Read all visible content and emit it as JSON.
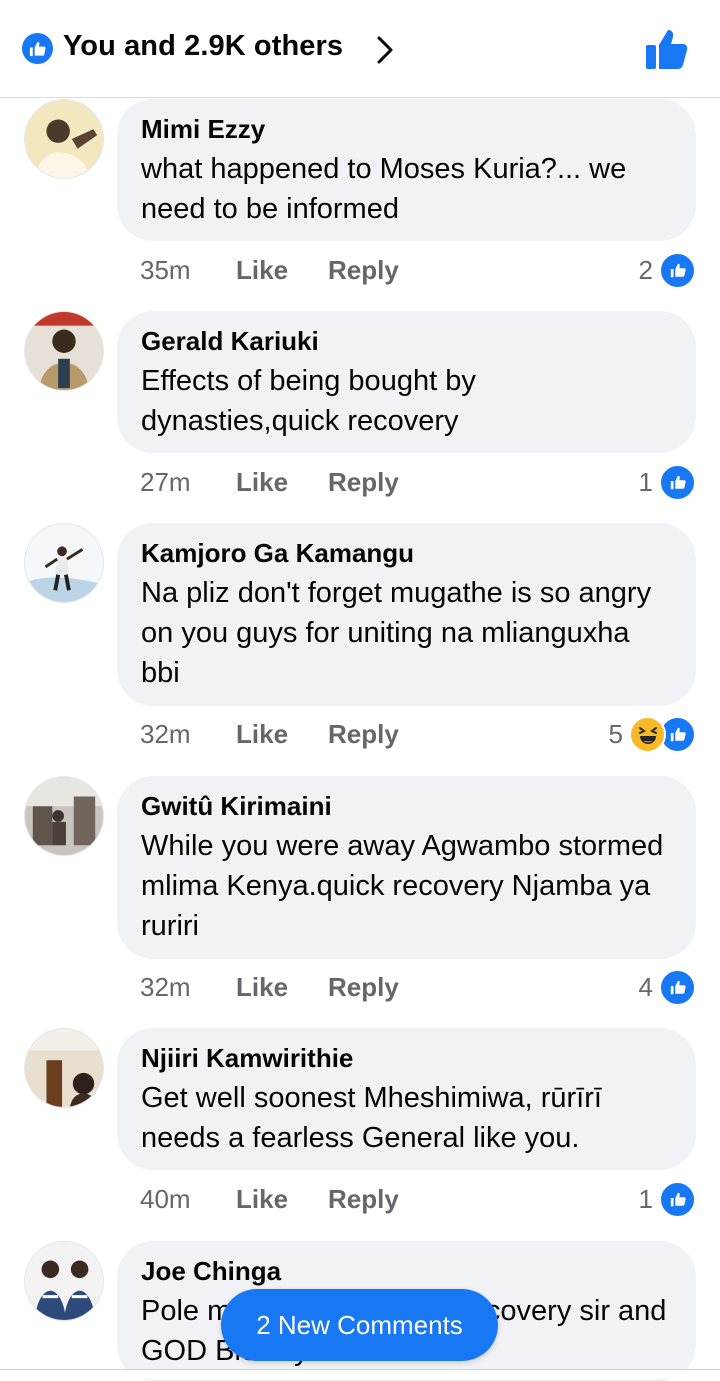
{
  "header": {
    "reactions_text": "You and 2.9K others",
    "like_icon": "like-icon",
    "chevron_icon": "chevron-right-icon",
    "thumb_icon": "thumbs-up-icon",
    "accent_color": "#1877f2"
  },
  "labels": {
    "like": "Like",
    "reply": "Reply"
  },
  "comments": [
    {
      "author": "Mimi Ezzy",
      "text": "what happened to Moses Kuria?... we need to be informed",
      "time": "35m",
      "reaction_count": "2",
      "reactions": [
        "like"
      ]
    },
    {
      "author": "Gerald Kariuki",
      "text": "Effects of being bought by dynasties,quick recovery",
      "time": "27m",
      "reaction_count": "1",
      "reactions": [
        "like"
      ]
    },
    {
      "author": "Kamjoro Ga Kamangu",
      "text": "Na pliz don't forget mugathe is so angry on you guys for uniting na mlianguxha bbi",
      "time": "32m",
      "reaction_count": "5",
      "reactions": [
        "haha",
        "like"
      ]
    },
    {
      "author": "Gwitû Kirimaini",
      "text": "While you were away Agwambo stormed mlima Kenya.quick recovery Njamba ya ruriri",
      "time": "32m",
      "reaction_count": "4",
      "reactions": [
        "like"
      ]
    },
    {
      "author": "Njiiri Kamwirithie",
      "text": "Get well soonest Mheshimiwa, rūrīrī needs a fearless General like you.",
      "time": "40m",
      "reaction_count": "1",
      "reactions": [
        "like"
      ]
    },
    {
      "author": "Joe Chinga",
      "text": "Pole mheshimiwa, quick recovery sir and GOD Bless you.",
      "time": "",
      "reaction_count": "",
      "reactions": []
    }
  ],
  "new_comments_button": "2 New Comments"
}
